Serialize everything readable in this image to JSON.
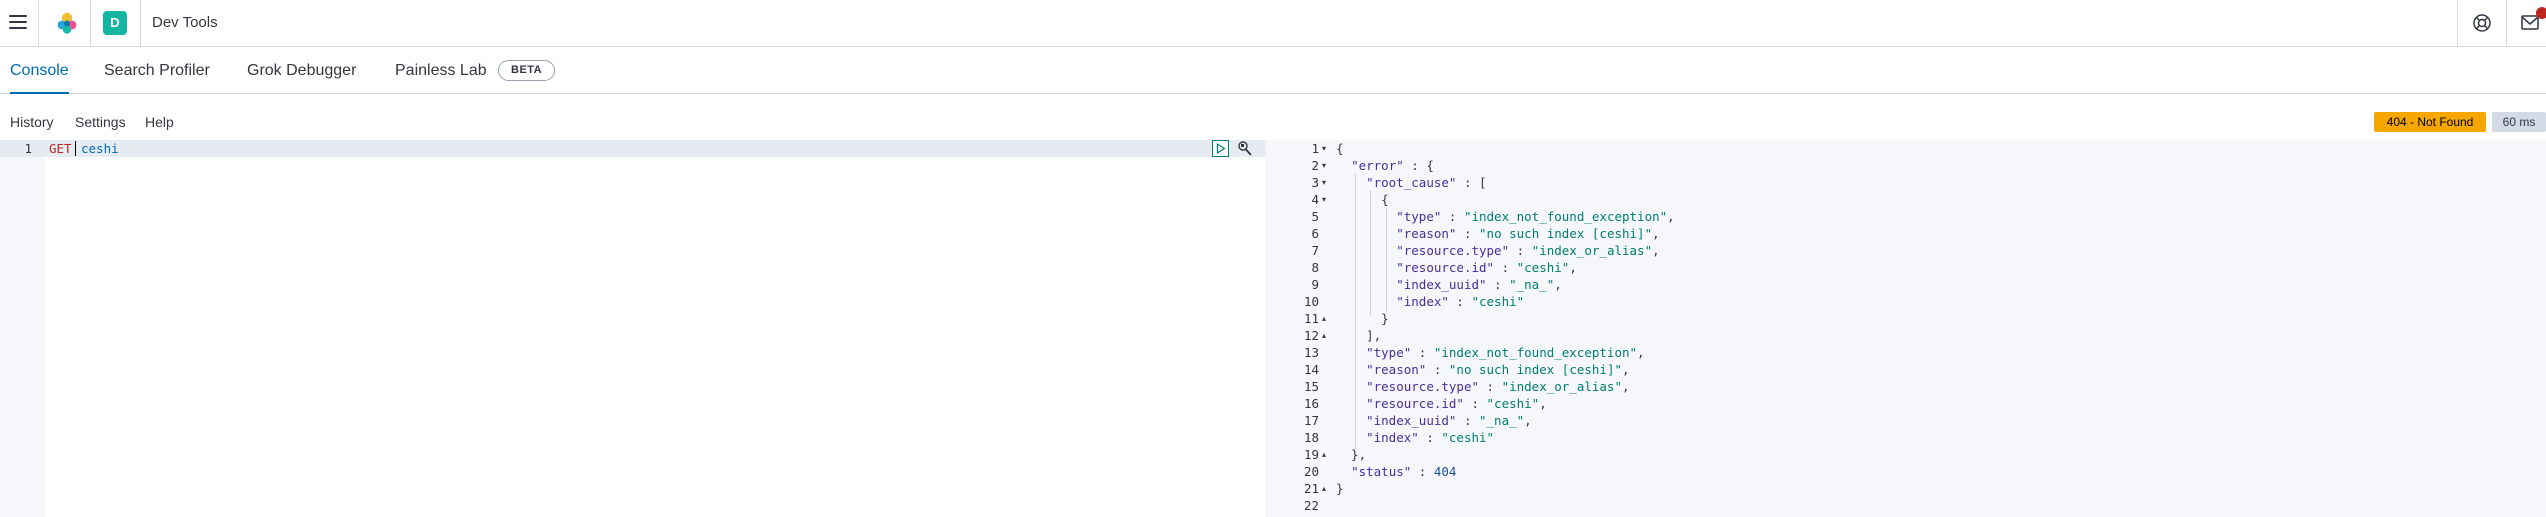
{
  "header": {
    "space_initial": "D",
    "app_title": "Dev Tools",
    "icons": [
      "menu-icon",
      "elastic-logo",
      "help-icon",
      "newsfeed-icon"
    ]
  },
  "tabs": [
    {
      "label": "Console",
      "active": true
    },
    {
      "label": "Search Profiler",
      "active": false
    },
    {
      "label": "Grok Debugger",
      "active": false
    },
    {
      "label": "Painless Lab",
      "active": false
    }
  ],
  "beta_badge": "BETA",
  "console_menu": {
    "history": "History",
    "settings": "Settings",
    "help": "Help"
  },
  "response_status": {
    "status": "404 - Not Found",
    "time": "60 ms"
  },
  "request": {
    "line_number": "1",
    "method": "GET",
    "path": "ceshi"
  },
  "response": {
    "lines": [
      {
        "n": "1",
        "text": "{"
      },
      {
        "n": "2",
        "text": "  \"error\" : {"
      },
      {
        "n": "3",
        "text": "    \"root_cause\" : ["
      },
      {
        "n": "4",
        "text": "      {"
      },
      {
        "n": "5",
        "text": "        \"type\" : \"index_not_found_exception\","
      },
      {
        "n": "6",
        "text": "        \"reason\" : \"no such index [ceshi]\","
      },
      {
        "n": "7",
        "text": "        \"resource.type\" : \"index_or_alias\","
      },
      {
        "n": "8",
        "text": "        \"resource.id\" : \"ceshi\","
      },
      {
        "n": "9",
        "text": "        \"index_uuid\" : \"_na_\","
      },
      {
        "n": "10",
        "text": "        \"index\" : \"ceshi\""
      },
      {
        "n": "11",
        "text": "      }"
      },
      {
        "n": "12",
        "text": "    ],"
      },
      {
        "n": "13",
        "text": "    \"type\" : \"index_not_found_exception\","
      },
      {
        "n": "14",
        "text": "    \"reason\" : \"no such index [ceshi]\","
      },
      {
        "n": "15",
        "text": "    \"resource.type\" : \"index_or_alias\","
      },
      {
        "n": "16",
        "text": "    \"resource.id\" : \"ceshi\","
      },
      {
        "n": "17",
        "text": "    \"index_uuid\" : \"_na_\","
      },
      {
        "n": "18",
        "text": "    \"index\" : \"ceshi\""
      },
      {
        "n": "19",
        "text": "  },"
      },
      {
        "n": "20",
        "text": "  \"status\" : 404"
      },
      {
        "n": "21",
        "text": "}"
      },
      {
        "n": "22",
        "text": ""
      }
    ]
  },
  "colors": {
    "accent": "#006bb4",
    "status_warning": "#f5a700",
    "space_avatar": "#14b6a1",
    "notification_badge": "#bd271e"
  }
}
